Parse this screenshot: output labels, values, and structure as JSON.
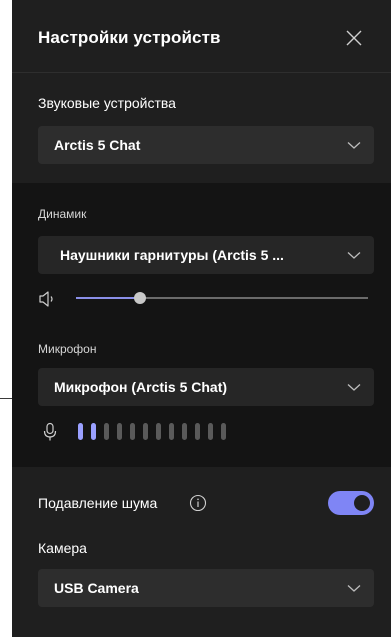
{
  "header": {
    "title": "Настройки устройств",
    "close_icon": "close-icon"
  },
  "audio_devices": {
    "label": "Звуковые устройства",
    "selected": "Arctis 5 Chat"
  },
  "speaker": {
    "label": "Динамик",
    "selected": "Наушники гарнитуры (Arctis 5 ...",
    "icon": "speaker-icon",
    "volume_fraction": 0.22
  },
  "microphone": {
    "label": "Микрофон",
    "selected": "Микрофон (Arctis 5 Chat)",
    "icon": "microphone-icon",
    "level_bars_total": 12,
    "level_bars_active": 2
  },
  "noise_suppression": {
    "label": "Подавление шума",
    "info_icon": "info-icon",
    "enabled": true
  },
  "camera": {
    "label": "Камера",
    "selected": "USB Camera"
  },
  "colors": {
    "accent": "#7f85f5",
    "panel_bg": "#1f1f1f",
    "section_dark_bg": "#141414"
  }
}
